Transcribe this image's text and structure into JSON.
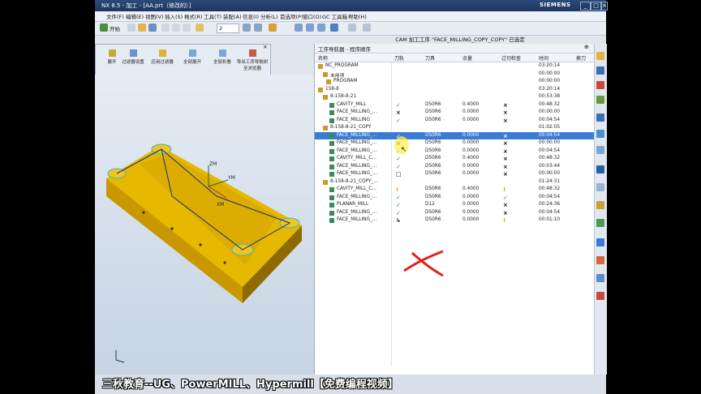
{
  "window": {
    "title": "NX 8.5 - 加工 - [AA.prt（修改的）]",
    "brand": "SIEMENS",
    "controls": [
      "_",
      "□",
      "×"
    ]
  },
  "menu": [
    "文件(F)",
    "编辑(E)",
    "视图(V)",
    "插入(S)",
    "格式(R)",
    "工具(T)",
    "装配(A)",
    "信息(I)",
    "分析(L)",
    "首选项(P)",
    "窗口(O)",
    "GC 工具箱",
    "帮助(H)"
  ],
  "toolbar": {
    "start_label": "开始",
    "layer_value": "2"
  },
  "cam_status": "CAM 加工工序 \"FACE_MILLING_COPY_COPY\" 已选定",
  "dialog": {
    "buttons": [
      "展开",
      "过滤器设置",
      "应用过滤器",
      "全部展开",
      "全部折叠",
      "导出工序导航树至浏览器"
    ]
  },
  "navigator": {
    "title": "工序导航器 - 程序顺序",
    "headers": [
      "名称",
      "刀轨",
      "刀具",
      "余量",
      "过切检查",
      "时间",
      "换刀"
    ],
    "rows": [
      {
        "name": "NC_PROGRAM",
        "path": "",
        "tool": "",
        "stock": "",
        "gouge": "",
        "time": "03:20:14",
        "sel": false
      },
      {
        "name": "未用项",
        "path": "",
        "tool": "",
        "stock": "",
        "gouge": "",
        "time": "00:00:00",
        "sel": false
      },
      {
        "name": "PROGRAM",
        "path": "",
        "tool": "",
        "stock": "",
        "gouge": "",
        "time": "00:00:00",
        "sel": false
      },
      {
        "name": "158-8",
        "path": "",
        "tool": "",
        "stock": "",
        "gouge": "",
        "time": "03:20:14",
        "sel": false
      },
      {
        "name": "8-158-8-21",
        "path": "",
        "tool": "",
        "stock": "",
        "gouge": "",
        "time": "00:53:38",
        "sel": false
      },
      {
        "name": "CAVITY_MILL",
        "path": "ok",
        "tool": "D50R6",
        "stock": "0.4000",
        "gouge": "×",
        "time": "00:48:32",
        "sel": false
      },
      {
        "name": "FACE_MILLING_...",
        "path": "×",
        "tool": "D50R6",
        "stock": "0.0000",
        "gouge": "×",
        "time": "00:00:00",
        "sel": false
      },
      {
        "name": "FACE_MILLING",
        "path": "ok",
        "tool": "D50R6",
        "stock": "0.0000",
        "gouge": "×",
        "time": "00:04:54",
        "sel": false
      },
      {
        "name": "8-158-8-21_COPY",
        "path": "",
        "tool": "",
        "stock": "",
        "gouge": "",
        "time": "01:02:05",
        "sel": false
      },
      {
        "name": "FACE_MILLING_...",
        "path": "ok",
        "tool": "D50R6",
        "stock": "0.0000",
        "gouge": "×",
        "time": "00:04:54",
        "sel": true
      },
      {
        "name": "FACE_MILLING_...",
        "path": "×",
        "tool": "D50R6",
        "stock": "0.0000",
        "gouge": "×",
        "time": "00:00:00",
        "sel": false
      },
      {
        "name": "FACE_MILLING_...",
        "path": "ok",
        "tool": "D50R6",
        "stock": "0.0000",
        "gouge": "×",
        "time": "00:04:54",
        "sel": false
      },
      {
        "name": "CAVITY_MILL_C...",
        "path": "ok",
        "tool": "D50R6",
        "stock": "0.4000",
        "gouge": "×",
        "time": "00:48:32",
        "sel": false
      },
      {
        "name": "FACE_MILLING_...",
        "path": "ok",
        "tool": "D50R6",
        "stock": "0.0000",
        "gouge": "×",
        "time": "00:03:44",
        "sel": false
      },
      {
        "name": "FACE_MILLING_...",
        "path": "□",
        "tool": "D50R6",
        "stock": "0.0000",
        "gouge": "×",
        "time": "00:00:00",
        "sel": false
      },
      {
        "name": "8-158-8-21_COPY_...",
        "path": "",
        "tool": "",
        "stock": "",
        "gouge": "",
        "time": "01:24:31",
        "sel": false
      },
      {
        "name": "CAVITY_MILL_C...",
        "path": "warn",
        "tool": "D50R6",
        "stock": "0.4000",
        "gouge": "!",
        "time": "00:48:32",
        "sel": false
      },
      {
        "name": "FACE_MILLING_...",
        "path": "ok",
        "tool": "D50R6",
        "stock": "0.0000",
        "gouge": "✓",
        "time": "00:04:54",
        "sel": false
      },
      {
        "name": "PLANAR_MILL",
        "path": "ok",
        "tool": "D12",
        "stock": "0.0000",
        "gouge": "×",
        "time": "00:24:36",
        "sel": false
      },
      {
        "name": "FACE_MILLING_...",
        "path": "ok",
        "tool": "D50R6",
        "stock": "0.0000",
        "gouge": "×",
        "time": "00:04:54",
        "sel": false
      },
      {
        "name": "FACE_MILLING_...",
        "path": "↳",
        "tool": "D50R6",
        "stock": "0.0000",
        "gouge": "!",
        "time": "00:01:10",
        "sel": false
      }
    ]
  },
  "viewport": {
    "axis_labels": [
      "ZM",
      "YM",
      "XM"
    ]
  },
  "watermark": "三秋教育--UG、PowerMILL、Hypermill【免费编程视频】"
}
